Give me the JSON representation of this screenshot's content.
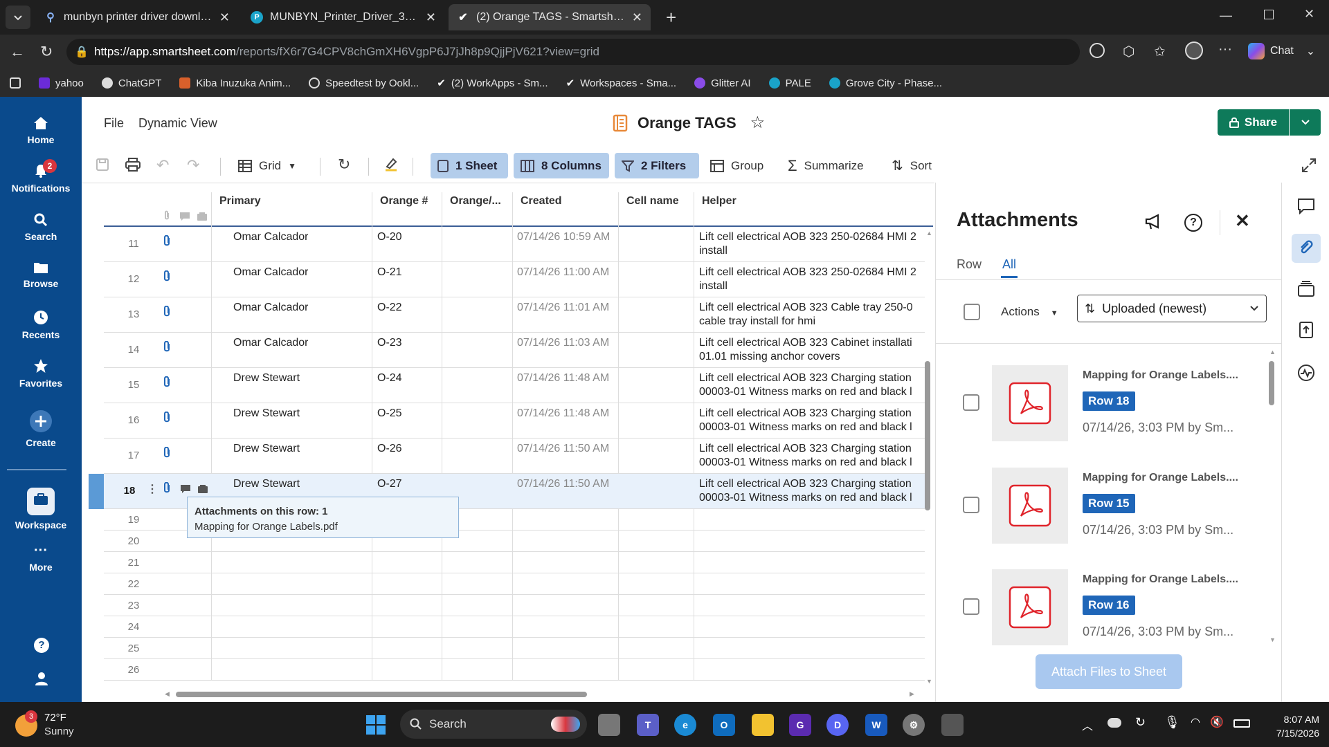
{
  "browser": {
    "tabs": [
      {
        "title": "munbyn printer driver download -",
        "active": false
      },
      {
        "title": "MUNBYN_Printer_Driver_3.2.4.530.",
        "active": false
      },
      {
        "title": "(2) Orange TAGS - Smartsheet.com",
        "active": true
      }
    ],
    "url_host": "https://app.smartsheet.com",
    "url_path": "/reports/fX6r7G4CPV8chGmXH6VgpP6J7jJh8p9QjjPjV621?view=grid",
    "chat_label": "Chat",
    "bookmarks": [
      "yahoo",
      "ChatGPT",
      "Kiba Inuzuka Anim...",
      "Speedtest by Ookl...",
      "(2) WorkApps - Sm...",
      "Workspaces - Sma...",
      "Glitter AI",
      "PALE",
      "Grove City - Phase..."
    ]
  },
  "nav": {
    "items": [
      "Home",
      "Notifications",
      "Search",
      "Browse",
      "Recents",
      "Favorites",
      "Create",
      "Workspace",
      "More"
    ],
    "notifications_badge": "2"
  },
  "header": {
    "menu_file": "File",
    "menu_view": "Dynamic View",
    "title": "Orange TAGS",
    "share": "Share"
  },
  "toolbar": {
    "grid": "Grid",
    "sheet": "1 Sheet",
    "columns": "8 Columns",
    "filters": "2 Filters",
    "group": "Group",
    "summarize": "Summarize",
    "sort": "Sort"
  },
  "grid": {
    "columns": [
      "Primary",
      "Orange #",
      "Orange/...",
      "Created",
      "Cell name",
      "Helper"
    ],
    "rows": [
      {
        "n": "11",
        "primary": "Omar Calcador",
        "orange": "O-20",
        "created": "07/14/26 10:59 AM",
        "helper1": "Lift cell electrical AOB 323 250-02684 HMI 2",
        "helper2": "install"
      },
      {
        "n": "12",
        "primary": "Omar Calcador",
        "orange": "O-21",
        "created": "07/14/26 11:00 AM",
        "helper1": "Lift cell electrical AOB 323 250-02684 HMI 2",
        "helper2": "install"
      },
      {
        "n": "13",
        "primary": "Omar Calcador",
        "orange": "O-22",
        "created": "07/14/26 11:01 AM",
        "helper1": "Lift cell electrical AOB 323 Cable tray 250-0",
        "helper2": "cable tray install for hmi"
      },
      {
        "n": "14",
        "primary": "Omar Calcador",
        "orange": "O-23",
        "created": "07/14/26 11:03 AM",
        "helper1": "Lift cell electrical AOB 323 Cabinet installati",
        "helper2": "01.01 missing anchor covers"
      },
      {
        "n": "15",
        "primary": "Drew Stewart",
        "orange": "O-24",
        "created": "07/14/26 11:48 AM",
        "helper1": "Lift cell electrical AOB 323 Charging station",
        "helper2": "00003-01 Witness marks on red and black l"
      },
      {
        "n": "16",
        "primary": "Drew Stewart",
        "orange": "O-25",
        "created": "07/14/26 11:48 AM",
        "helper1": "Lift cell electrical AOB 323 Charging station",
        "helper2": "00003-01 Witness marks on red and black l"
      },
      {
        "n": "17",
        "primary": "Drew Stewart",
        "orange": "O-26",
        "created": "07/14/26 11:50 AM",
        "helper1": "Lift cell electrical AOB 323 Charging station",
        "helper2": "00003-01 Witness marks on red and black l"
      },
      {
        "n": "18",
        "primary": "Drew Stewart",
        "orange": "O-27",
        "created": "07/14/26 11:50 AM",
        "helper1": "Lift cell electrical AOB 323 Charging station",
        "helper2": "00003-01 Witness marks on red and black l"
      }
    ],
    "empty_rows": [
      "19",
      "20",
      "21",
      "22",
      "23",
      "24",
      "25",
      "26"
    ],
    "tooltip_title": "Attachments on this row: 1",
    "tooltip_file": "Mapping for Orange Labels.pdf"
  },
  "attachments": {
    "title": "Attachments",
    "tab_row": "Row",
    "tab_all": "All",
    "actions": "Actions",
    "sort_value": "Uploaded (newest)",
    "items": [
      {
        "name": "Mapping for Orange Labels....",
        "row": "Row 18",
        "meta": "07/14/26, 3:03 PM by Sm..."
      },
      {
        "name": "Mapping for Orange Labels....",
        "row": "Row 15",
        "meta": "07/14/26, 3:03 PM by Sm..."
      },
      {
        "name": "Mapping for Orange Labels....",
        "row": "Row 16",
        "meta": "07/14/26, 3:03 PM by Sm..."
      }
    ],
    "attach_button": "Attach Files to Sheet"
  },
  "taskbar": {
    "weather_temp": "72°F",
    "weather_desc": "Sunny",
    "weather_badge": "3",
    "search": "Search",
    "time": "8:07 AM",
    "date": "7/15/2026"
  },
  "colors": {
    "nav_bg": "#0a4a8c",
    "accent": "#1f66b8",
    "share_green": "#0e7a5a",
    "pill_blue": "#b3cdeb",
    "pdf_red": "#e0242b"
  }
}
